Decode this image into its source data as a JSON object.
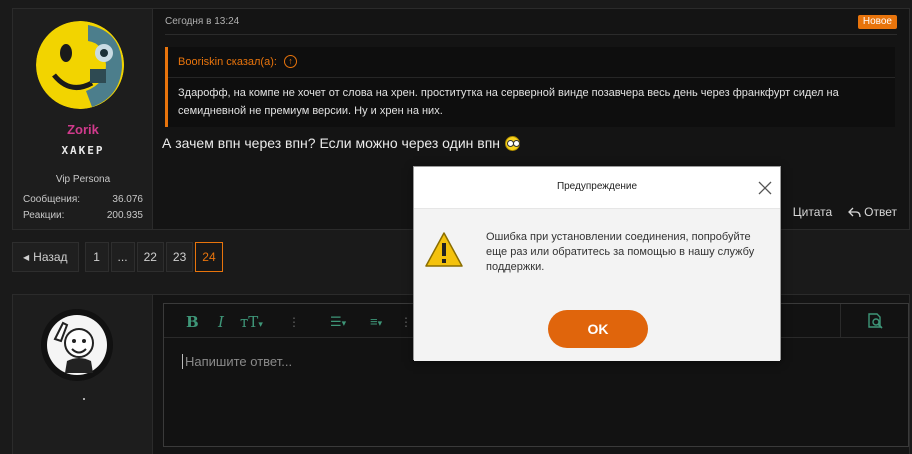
{
  "post": {
    "author": {
      "name": "Zorik",
      "title": "ХАКЕР",
      "role": "Vip Persona",
      "stats": [
        {
          "label": "Сообщения:",
          "value": "36.076"
        },
        {
          "label": "Реакции:",
          "value": "200.935"
        }
      ]
    },
    "time": "Сегодня в 13:24",
    "badge": "Новое",
    "quote": {
      "author_line": "Booriskin сказал(а):",
      "text": "Здарофф, на компе не хочет от слова на хрен. проститутка на серверной винде позавчера весь день через франкфурт сидел на семидневной не премиум версии. Ну и хрен на них."
    },
    "text": "А зачем впн через впн? Если можно через один впн",
    "actions": {
      "quote": "Цитата",
      "reply": "Ответ"
    }
  },
  "pagination": {
    "back": "Назад",
    "pages": [
      "1",
      "...",
      "22",
      "23",
      "24"
    ],
    "current": "24"
  },
  "editor": {
    "placeholder": "Напишите ответ..."
  },
  "dialog": {
    "title": "Предупреждение",
    "message": "Ошибка при установлении соединения, попробуйте еще раз или обратитесь за помощью в нашу службу поддержки.",
    "ok_label": "OK"
  },
  "colors": {
    "accent": "#e8740c",
    "username": "#d03a8c",
    "toolbar_icons": "#3e9678",
    "ok_button": "#e0650c"
  }
}
